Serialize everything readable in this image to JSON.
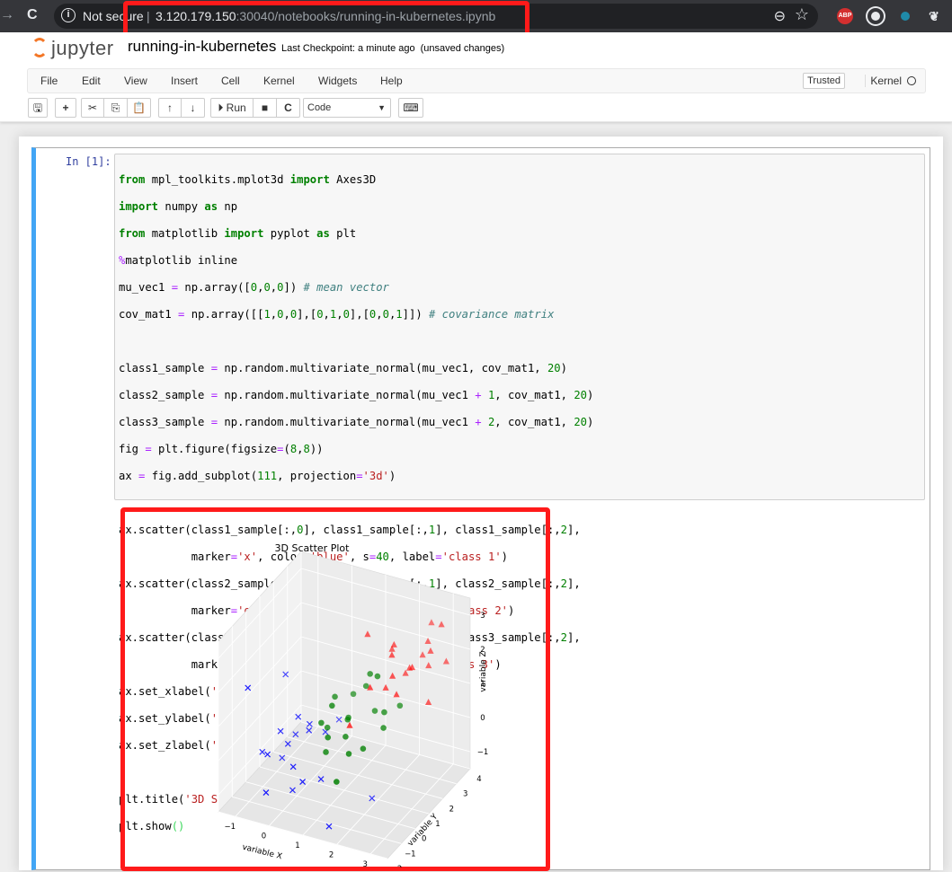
{
  "browser": {
    "nav_back": "→",
    "nav_reload": "C",
    "secure_label": "Not secure",
    "separator": "|",
    "host": "3.120.179.150",
    "path": ":30040/notebooks/running-in-kubernetes.ipynb",
    "zoom_icon": "⊖",
    "star_icon": "☆",
    "extensions": [
      {
        "label": "ABP",
        "color": "#d32f2f"
      },
      {
        "label": "",
        "color": "#e8eaed"
      },
      {
        "label": "",
        "color": "#1f8aa8"
      },
      {
        "label": "",
        "color": "#e8eaed"
      }
    ]
  },
  "header": {
    "logo_text": "jupyter",
    "notebook_name": "running-in-kubernetes",
    "checkpoint": "Last Checkpoint: a minute ago",
    "unsaved": "(unsaved changes)"
  },
  "menu": {
    "items": [
      "File",
      "Edit",
      "View",
      "Insert",
      "Cell",
      "Kernel",
      "Widgets",
      "Help"
    ],
    "trusted": "Trusted",
    "kernel": "Kernel"
  },
  "toolbar": {
    "save_icon": "🖫",
    "add_icon": "+",
    "cut_icon": "✂",
    "copy_icon": "⎘",
    "paste_icon": "📋",
    "up_icon": "↑",
    "down_icon": "↓",
    "run_label": "Run",
    "stop_icon": "■",
    "restart_icon": "C",
    "cell_type": "Code",
    "keyboard_icon": "⌨"
  },
  "cell": {
    "prompt": "In [1]:"
  },
  "chart_data": {
    "type": "scatter",
    "title": "3D Scatter Plot",
    "xlabel": "variable X",
    "ylabel": "variable Y",
    "zlabel": "variable Z",
    "x_ticks": [
      "−1",
      "0",
      "1",
      "2",
      "3"
    ],
    "y_ticks": [
      "−2",
      "−1",
      "0",
      "1",
      "2",
      "3",
      "4"
    ],
    "z_ticks": [
      "−1",
      "0",
      "1",
      "2",
      "3"
    ],
    "xlim": [
      -1.5,
      3.5
    ],
    "ylim": [
      -2,
      4
    ],
    "zlim": [
      -1.5,
      3.5
    ],
    "grid": true,
    "series": [
      {
        "name": "class 1",
        "color": "#0000ff",
        "marker": "x",
        "points": [
          [
            -1.2,
            -0.6,
            1.6
          ],
          [
            -0.9,
            1.4,
            1.2
          ],
          [
            -1.1,
            0.2,
            -0.6
          ],
          [
            -0.7,
            -0.4,
            -0.3
          ],
          [
            -0.3,
            0.1,
            -0.1
          ],
          [
            0.2,
            0.4,
            0.3
          ],
          [
            -0.2,
            0.6,
            0.5
          ],
          [
            0.4,
            1.1,
            0.0
          ],
          [
            0.1,
            -0.5,
            -0.4
          ],
          [
            -0.8,
            0.9,
            -1.0
          ],
          [
            0.5,
            -0.8,
            -0.6
          ],
          [
            0.0,
            -0.3,
            -1.2
          ],
          [
            1.9,
            0.8,
            -1.4
          ],
          [
            -0.5,
            -1.0,
            -1.1
          ],
          [
            0.6,
            1.6,
            0.2
          ],
          [
            -0.4,
            0.9,
            -0.2
          ],
          [
            1.2,
            -0.6,
            -1.8
          ],
          [
            0.3,
            0.2,
            0.6
          ],
          [
            -0.6,
            0.3,
            0.1
          ],
          [
            0.8,
            -0.2,
            -0.7
          ]
        ]
      },
      {
        "name": "class 2",
        "color": "#008000",
        "marker": "o",
        "points": [
          [
            0.8,
            0.6,
            1.1
          ],
          [
            1.6,
            1.4,
            1.9
          ],
          [
            2.1,
            1.2,
            1.0
          ],
          [
            1.2,
            0.6,
            0.3
          ],
          [
            1.4,
            1.6,
            1.4
          ],
          [
            0.6,
            1.3,
            1.0
          ],
          [
            1.8,
            0.4,
            0.2
          ],
          [
            0.4,
            0.8,
            0.4
          ],
          [
            1.1,
            1.0,
            0.6
          ],
          [
            2.4,
            1.6,
            1.1
          ],
          [
            0.9,
            1.9,
            0.9
          ],
          [
            1.5,
            0.1,
            0.1
          ],
          [
            2.2,
            0.9,
            0.7
          ],
          [
            0.7,
            0.4,
            -0.2
          ],
          [
            1.0,
            1.3,
            0.5
          ],
          [
            1.7,
            1.5,
            0.8
          ],
          [
            0.5,
            1.0,
            0.2
          ],
          [
            1.9,
            1.2,
            2.0
          ],
          [
            1.3,
            -0.3,
            -0.6
          ],
          [
            0.8,
            0.3,
            0.3
          ]
        ]
      },
      {
        "name": "class 3",
        "color": "#ff0000",
        "marker": "^",
        "points": [
          [
            2.6,
            3.4,
            2.8
          ],
          [
            3.1,
            2.9,
            3.1
          ],
          [
            2.9,
            2.6,
            2.4
          ],
          [
            1.2,
            2.2,
            2.6
          ],
          [
            2.0,
            2.0,
            2.3
          ],
          [
            2.4,
            2.3,
            1.9
          ],
          [
            1.9,
            1.8,
            1.4
          ],
          [
            2.8,
            2.7,
            1.9
          ],
          [
            3.0,
            2.2,
            1.1
          ],
          [
            2.2,
            2.5,
            1.6
          ],
          [
            1.6,
            1.4,
            1.5
          ],
          [
            2.5,
            3.0,
            2.0
          ],
          [
            2.1,
            1.8,
            1.8
          ],
          [
            3.2,
            3.0,
            2.0
          ],
          [
            1.9,
            2.4,
            2.4
          ],
          [
            1.2,
            0.9,
            0.5
          ],
          [
            2.3,
            1.6,
            1.4
          ],
          [
            2.7,
            2.9,
            2.5
          ],
          [
            1.8,
            2.5,
            2.2
          ],
          [
            2.6,
            2.0,
            2.1
          ]
        ]
      }
    ]
  }
}
